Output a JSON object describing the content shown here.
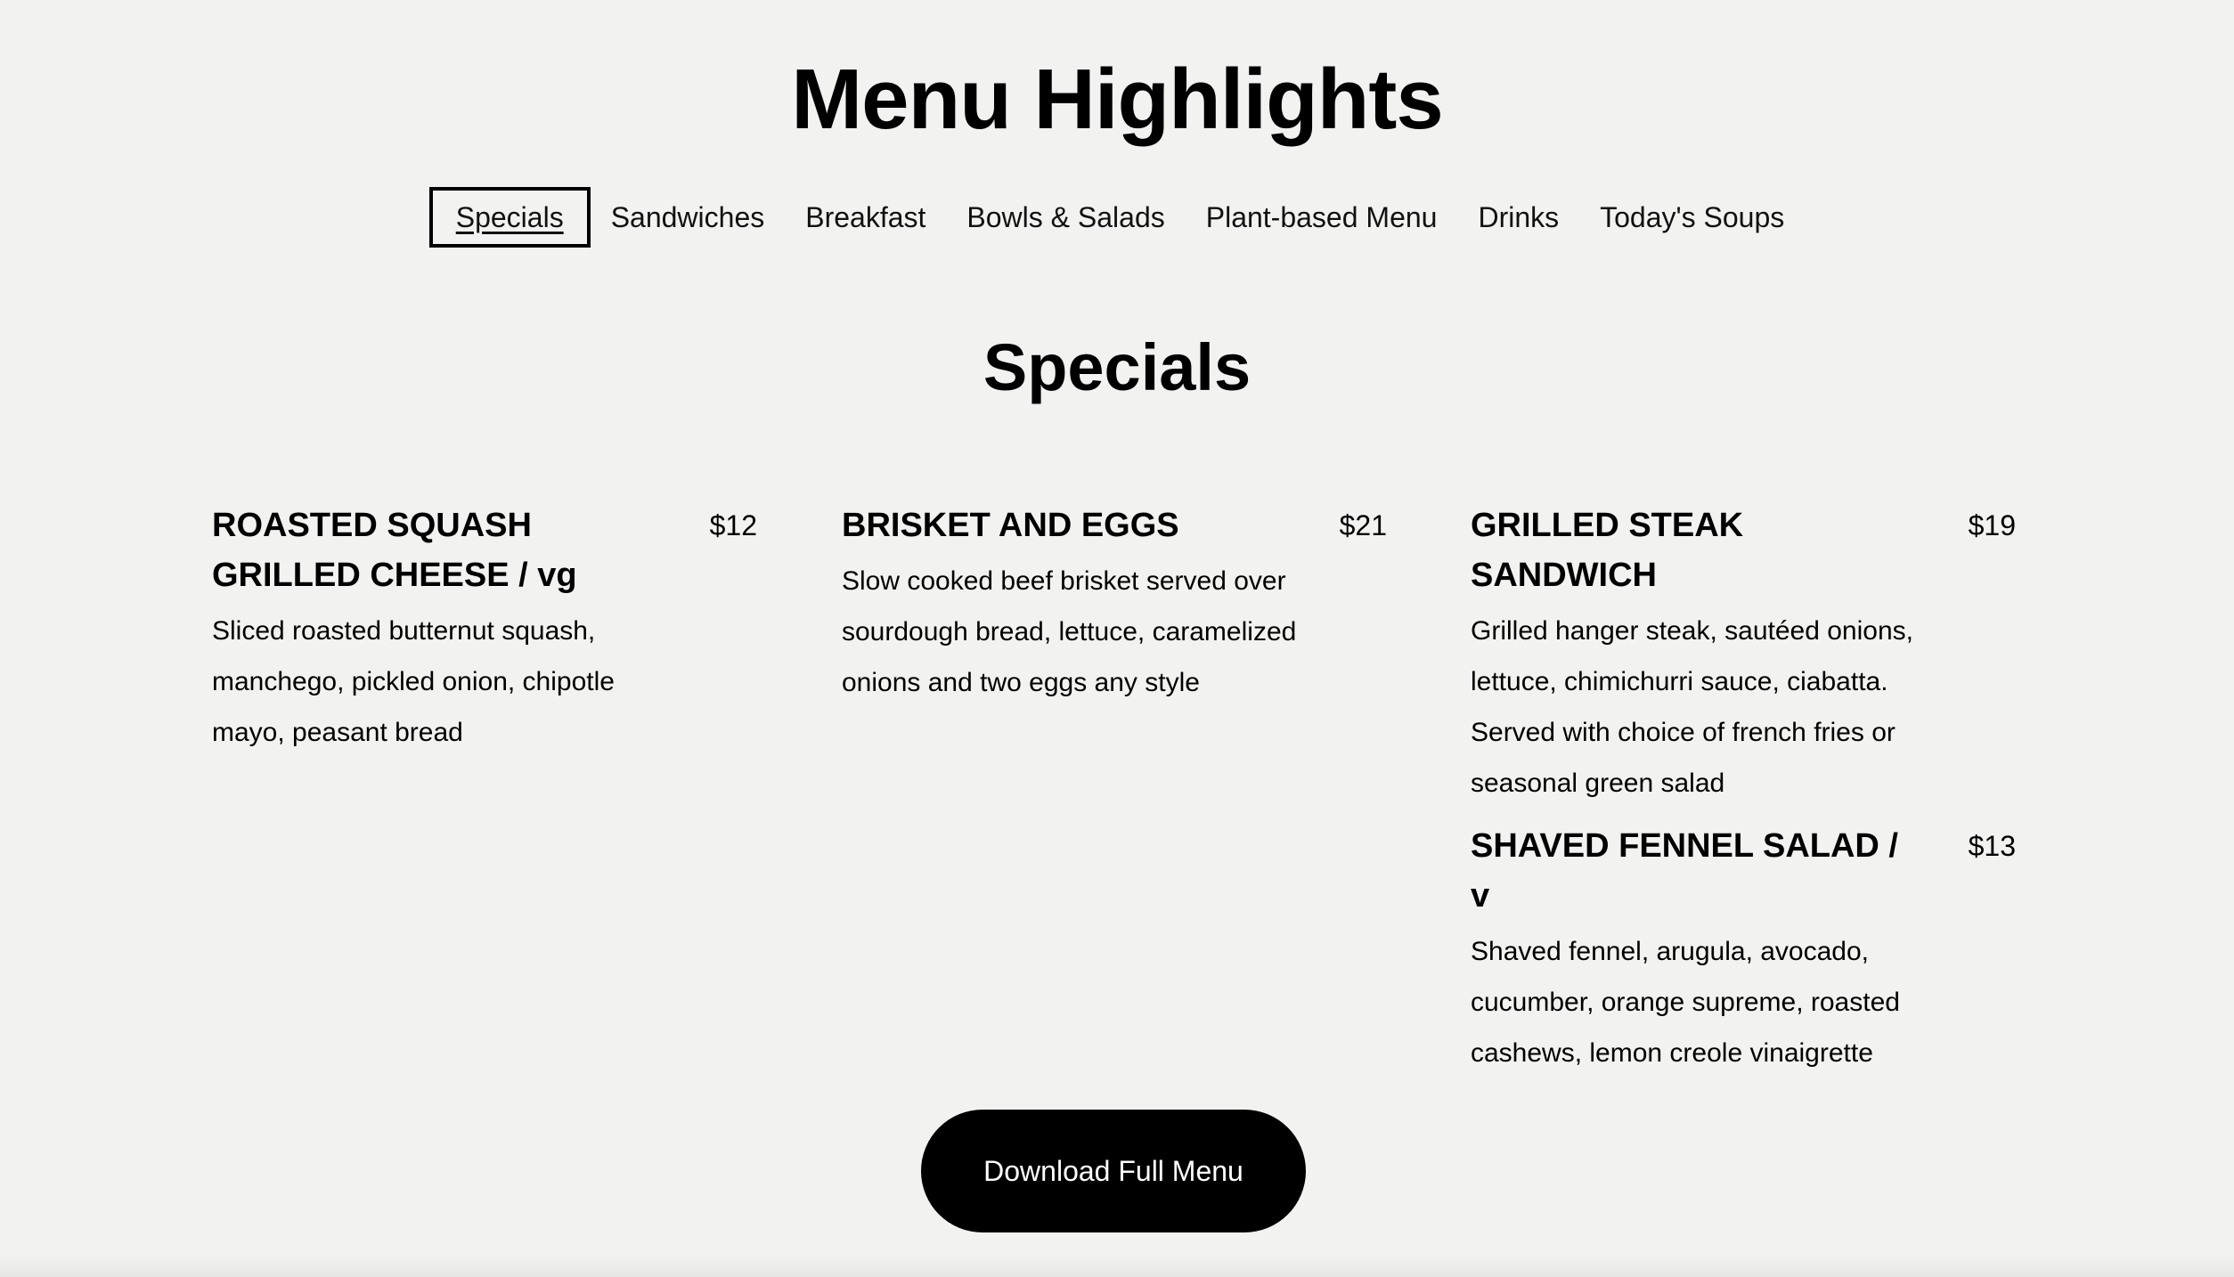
{
  "page": {
    "title": "Menu Highlights"
  },
  "tabs": [
    {
      "label": "Specials",
      "active": true
    },
    {
      "label": "Sandwiches",
      "active": false
    },
    {
      "label": "Breakfast",
      "active": false
    },
    {
      "label": "Bowls & Salads",
      "active": false
    },
    {
      "label": "Plant-based Menu",
      "active": false
    },
    {
      "label": "Drinks",
      "active": false
    },
    {
      "label": "Today's Soups",
      "active": false
    }
  ],
  "section": {
    "title": "Specials"
  },
  "items": [
    {
      "name": "ROASTED SQUASH GRILLED CHEESE / vg",
      "price": "$12",
      "description": "Sliced roasted butternut squash, manchego, pickled onion, chipotle mayo, peasant bread"
    },
    {
      "name": "BRISKET AND EGGS",
      "price": "$21",
      "description": "Slow cooked beef brisket served over sourdough bread, lettuce, caramelized onions and two eggs any style"
    },
    {
      "name": "GRILLED STEAK SANDWICH",
      "price": "$19",
      "description": "Grilled hanger steak, sautéed onions, lettuce, chimichurri sauce, ciabatta. Served with choice of french fries or seasonal green salad"
    },
    {
      "name": "SHAVED FENNEL SALAD / v",
      "price": "$13",
      "description": "Shaved fennel, arugula, avocado, cucumber, orange supreme, roasted cashews, lemon creole vinaigrette"
    }
  ],
  "actions": {
    "download_label": "Download Full Menu"
  },
  "colors": {
    "background": "#f2f2f0",
    "text": "#000000",
    "button_bg": "#000000",
    "button_text": "#ffffff"
  }
}
